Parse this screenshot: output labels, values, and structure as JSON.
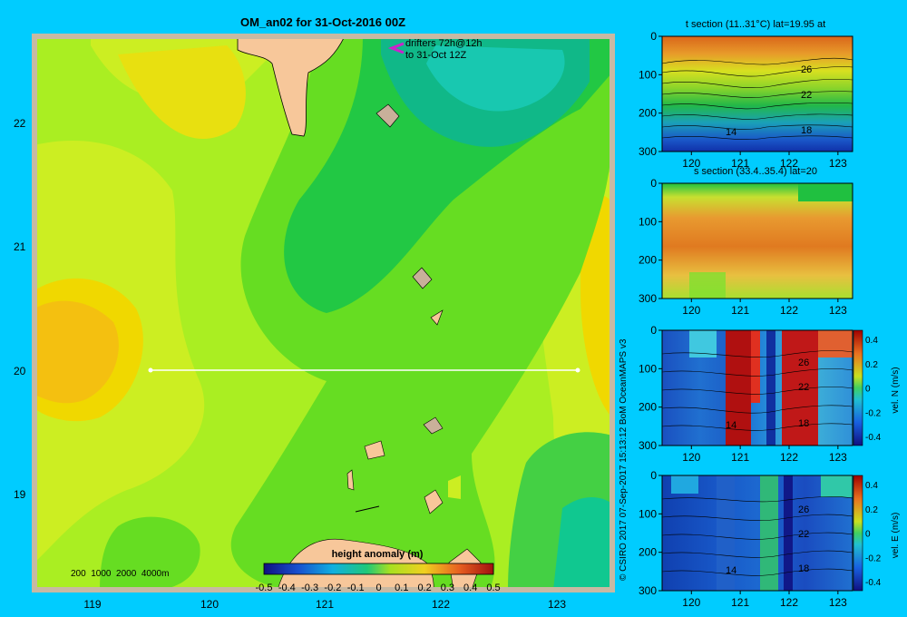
{
  "main_map": {
    "title": "OM_an02 for 31-Oct-2016 00Z",
    "drifters_line1": "drifters 72h@12h",
    "drifters_line2": "to 31-Oct 12Z",
    "lat_ticks": [
      "22",
      "21",
      "20",
      "19"
    ],
    "lon_ticks": [
      "119",
      "120",
      "121",
      "122",
      "123"
    ],
    "depth_legend": "200  1000  2000  4000m",
    "colorbar_title": "height anomaly (m)",
    "colorbar_ticks": [
      "-0.5",
      "-0.4",
      "-0.3",
      "-0.2",
      "-0.1",
      "0",
      "0.1",
      "0.2",
      "0.3",
      "0.4",
      "0.5"
    ],
    "section_line": {
      "lat": 20.0,
      "lon_start": 119.5,
      "lon_end": 123.2
    }
  },
  "credit": "© CSIRO 2017   07-Sep-2017 15:13:12 BoM OceanMAPS v3",
  "chart_data": [
    {
      "type": "heatmap",
      "title": "t section (11..31°C) lat=19.95 at",
      "x_ticks": [
        "120",
        "121",
        "122",
        "123"
      ],
      "y_ticks": [
        "0",
        "100",
        "200",
        "300"
      ],
      "contour_labels": [
        "26",
        "22",
        "18",
        "14"
      ]
    },
    {
      "type": "heatmap",
      "title": "s section (33.4..35.4) lat=20",
      "x_ticks": [
        "120",
        "121",
        "122",
        "123"
      ],
      "y_ticks": [
        "0",
        "100",
        "200",
        "300"
      ]
    },
    {
      "type": "heatmap",
      "title": "",
      "x_ticks": [
        "120",
        "121",
        "122",
        "123"
      ],
      "y_ticks": [
        "0",
        "100",
        "200",
        "300"
      ],
      "contour_labels": [
        "26",
        "22",
        "18",
        "14"
      ],
      "colorbar_label": "vel. N (m/s)",
      "colorbar_ticks": [
        "0.4",
        "0.2",
        "0",
        "-0.2",
        "-0.4"
      ]
    },
    {
      "type": "heatmap",
      "title": "",
      "x_ticks": [
        "120",
        "121",
        "122",
        "123"
      ],
      "y_ticks": [
        "0",
        "100",
        "200",
        "300"
      ],
      "contour_labels": [
        "26",
        "22",
        "18",
        "14"
      ],
      "colorbar_label": "vel. E (m/s)",
      "colorbar_ticks": [
        "0.4",
        "0.2",
        "0",
        "-0.2",
        "-0.4"
      ]
    }
  ]
}
